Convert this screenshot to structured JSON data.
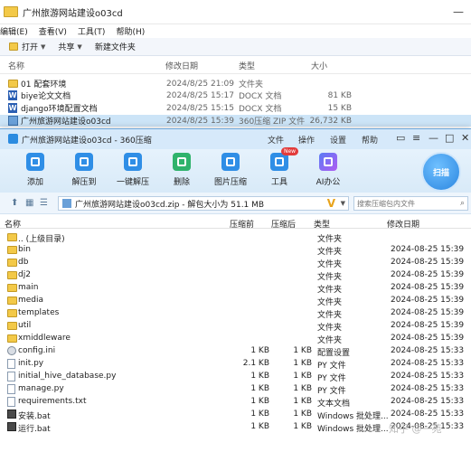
{
  "explorer": {
    "title": "广州旅游网站建设o03cd",
    "menu": [
      "编辑(E)",
      "查看(V)",
      "工具(T)",
      "帮助(H)"
    ],
    "toolbar": {
      "open": "打开",
      "share": "共享",
      "new_folder": "新建文件夹"
    },
    "columns": {
      "name": "名称",
      "date": "修改日期",
      "type": "类型",
      "size": "大小"
    },
    "rows": [
      {
        "name": "01 配套环境",
        "date": "2024/8/25 21:09",
        "type": "文件夹",
        "size": "",
        "icon": "folder-icon"
      },
      {
        "name": "biye论文文档",
        "date": "2024/8/25 15:17",
        "type": "DOCX 文档",
        "size": "81 KB",
        "icon": "word-icon"
      },
      {
        "name": "django环境配置文档",
        "date": "2024/8/25 15:15",
        "type": "DOCX 文档",
        "size": "15 KB",
        "icon": "word-icon"
      },
      {
        "name": "广州旅游网站建设o03cd",
        "date": "2024/8/25 15:39",
        "type": "360压缩 ZIP 文件",
        "size": "26,732 KB",
        "icon": "zip-icon"
      }
    ]
  },
  "zip": {
    "title": "广州旅游网站建设o03cd - 360压缩",
    "menu": [
      "文件",
      "操作",
      "设置",
      "帮助"
    ],
    "toolbar": [
      {
        "label": "添加",
        "icon": "add-icon"
      },
      {
        "label": "解压到",
        "icon": "extract-to-icon"
      },
      {
        "label": "一键解压",
        "icon": "one-click-extract-icon"
      },
      {
        "label": "删除",
        "icon": "delete-icon"
      },
      {
        "label": "图片压缩",
        "icon": "image-compress-icon"
      },
      {
        "label": "工具",
        "icon": "tools-icon"
      },
      {
        "label": "AI办公",
        "icon": "ai-icon"
      }
    ],
    "new_badge": "New",
    "scan_label": "扫描",
    "path": "广州旅游网站建设o03cd.zip - 解包大小为 51.1 MB",
    "search_placeholder": "搜索压缩包内文件",
    "columns": {
      "name": "名称",
      "compressed": "压缩前",
      "after": "压缩后",
      "type": "类型",
      "date": "修改日期"
    },
    "rows": [
      {
        "name": ".. (上级目录)",
        "before": "",
        "after": "",
        "type": "文件夹",
        "date": "",
        "icon": "folder"
      },
      {
        "name": "bin",
        "before": "",
        "after": "",
        "type": "文件夹",
        "date": "2024-08-25 15:39",
        "icon": "folder"
      },
      {
        "name": "db",
        "before": "",
        "after": "",
        "type": "文件夹",
        "date": "2024-08-25 15:39",
        "icon": "folder"
      },
      {
        "name": "dj2",
        "before": "",
        "after": "",
        "type": "文件夹",
        "date": "2024-08-25 15:39",
        "icon": "folder"
      },
      {
        "name": "main",
        "before": "",
        "after": "",
        "type": "文件夹",
        "date": "2024-08-25 15:39",
        "icon": "folder"
      },
      {
        "name": "media",
        "before": "",
        "after": "",
        "type": "文件夹",
        "date": "2024-08-25 15:39",
        "icon": "folder"
      },
      {
        "name": "templates",
        "before": "",
        "after": "",
        "type": "文件夹",
        "date": "2024-08-25 15:39",
        "icon": "folder"
      },
      {
        "name": "util",
        "before": "",
        "after": "",
        "type": "文件夹",
        "date": "2024-08-25 15:39",
        "icon": "folder"
      },
      {
        "name": "xmiddleware",
        "before": "",
        "after": "",
        "type": "文件夹",
        "date": "2024-08-25 15:39",
        "icon": "folder"
      },
      {
        "name": "config.ini",
        "before": "1 KB",
        "after": "1 KB",
        "type": "配置设置",
        "date": "2024-08-25 15:33",
        "icon": "ini"
      },
      {
        "name": "init.py",
        "before": "2.1 KB",
        "after": "1 KB",
        "type": "PY 文件",
        "date": "2024-08-25 15:33",
        "icon": "py"
      },
      {
        "name": "initial_hive_database.py",
        "before": "1 KB",
        "after": "1 KB",
        "type": "PY 文件",
        "date": "2024-08-25 15:33",
        "icon": "py"
      },
      {
        "name": "manage.py",
        "before": "1 KB",
        "after": "1 KB",
        "type": "PY 文件",
        "date": "2024-08-25 15:33",
        "icon": "py"
      },
      {
        "name": "requirements.txt",
        "before": "1 KB",
        "after": "1 KB",
        "type": "文本文档",
        "date": "2024-08-25 15:33",
        "icon": "txt"
      },
      {
        "name": "安装.bat",
        "before": "1 KB",
        "after": "1 KB",
        "type": "Windows 批处理...",
        "date": "2024-08-25 15:33",
        "icon": "bat"
      },
      {
        "name": "运行.bat",
        "before": "1 KB",
        "after": "1 KB",
        "type": "Windows 批处理...",
        "date": "2024-08-25 15:33",
        "icon": "bat"
      }
    ]
  },
  "watermark": "知乎 @一苑"
}
